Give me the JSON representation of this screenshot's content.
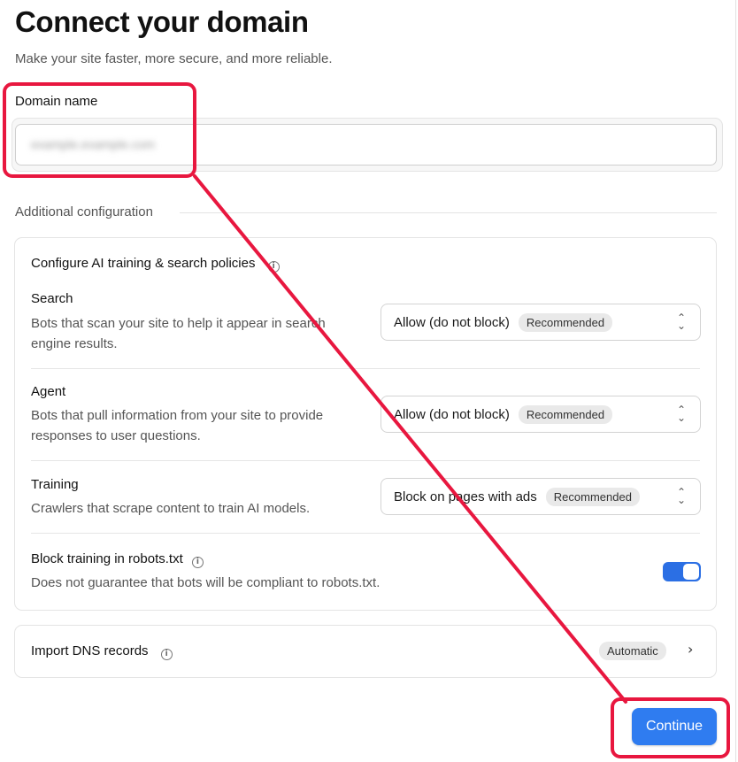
{
  "header": {
    "title": "Connect your domain",
    "subtitle": "Make your site faster, more secure, and more reliable."
  },
  "domain": {
    "label": "Domain name",
    "value": "example.example.com"
  },
  "additional": {
    "label": "Additional configuration",
    "policies_title": "Configure AI training & search policies",
    "policies": [
      {
        "name": "Search",
        "description": "Bots that scan your site to help it appear in search engine results.",
        "value": "Allow (do not block)",
        "badge": "Recommended"
      },
      {
        "name": "Agent",
        "description": "Bots that pull information from your site to provide responses to user questions.",
        "value": "Allow (do not block)",
        "badge": "Recommended"
      },
      {
        "name": "Training",
        "description": "Crawlers that scrape content to train AI models.",
        "value": "Block on pages with ads",
        "badge": "Recommended"
      }
    ],
    "robots": {
      "name": "Block training in robots.txt",
      "description": "Does not guarantee that bots will be compliant to robots.txt.",
      "enabled": true
    }
  },
  "dns": {
    "title": "Import DNS records",
    "badge": "Automatic"
  },
  "actions": {
    "continue_label": "Continue"
  },
  "colors": {
    "accent": "#2f7cf0",
    "annotation": "#e8173f"
  },
  "icons": {
    "info": "info-icon",
    "select": "chevron-up-down-icon",
    "dns": "chevron-right-icon"
  }
}
